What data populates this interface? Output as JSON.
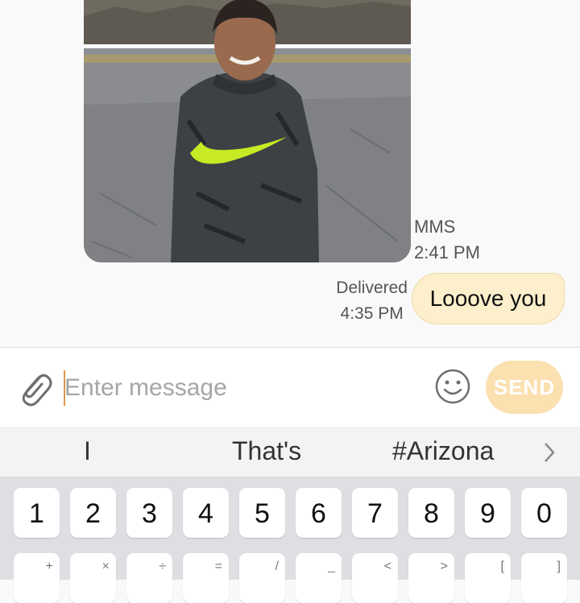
{
  "conversation": {
    "received_mms": {
      "image_description": "photo-of-boy-in-nike-hoodie",
      "type_label": "MMS",
      "time": "2:41 PM"
    },
    "sent_message": {
      "status": "Delivered",
      "time": "4:35 PM",
      "text": "Looove you"
    }
  },
  "composer": {
    "placeholder": "Enter message",
    "value": "",
    "send_label": "SEND",
    "attach_icon": "paperclip-icon",
    "emoji_icon": "smiley-icon"
  },
  "suggestions": {
    "items": [
      "I",
      "That's",
      "#Arizona"
    ],
    "more_icon": "chevron-right-icon"
  },
  "keyboard": {
    "number_row": [
      "1",
      "2",
      "3",
      "4",
      "5",
      "6",
      "7",
      "8",
      "9",
      "0"
    ],
    "symbol_row": [
      "+",
      "×",
      "÷",
      "=",
      "/",
      "_",
      "<",
      ">",
      "[",
      "]"
    ]
  },
  "colors": {
    "sent_bubble": "#fdefcc",
    "send_button": "#fbe0b0",
    "caret": "#e0954b",
    "keyboard_bg": "#dedfe3"
  }
}
